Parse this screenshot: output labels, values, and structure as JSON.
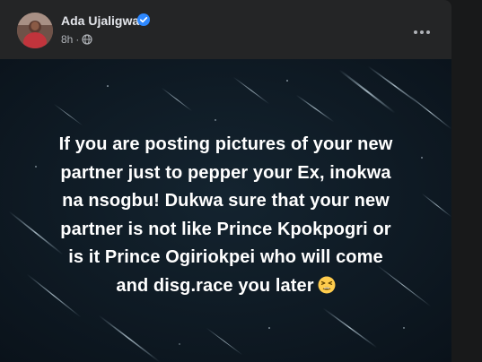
{
  "post": {
    "author": "Ada Ujaligwa",
    "time": "8h",
    "separator": "·",
    "privacy_icon": "globe-icon",
    "verified_icon": "verified-badge-icon",
    "more_icon": "more-horizontal-icon",
    "text_lines": [
      "If you are posting pictures of your new",
      "partner just to pepper your Ex, inokwa",
      "na nsogbu! Dukwa sure that your new",
      "partner is not like Prince Kpokpogri or",
      "is it Prince Ogiriokpei who will come",
      "and disg.race you later"
    ],
    "emoji_icon": "tired-face-emoji-icon"
  },
  "colors": {
    "card": "#242526",
    "page": "#18191a",
    "verified": "#2d88ff",
    "media_bg": "#0e1820",
    "text_primary": "#e4e6eb",
    "text_secondary": "#b0b3b8"
  }
}
